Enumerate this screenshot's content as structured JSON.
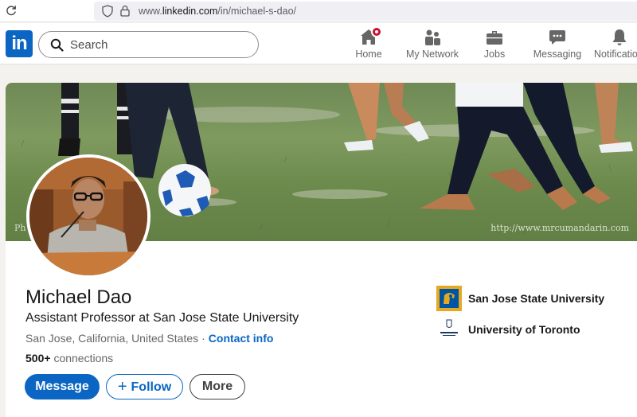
{
  "browser": {
    "url_prefix": "www.",
    "url_domain": "linkedin.com",
    "url_path": "/in/michael-s-dao/"
  },
  "nav": {
    "logo_text": "in",
    "search_placeholder": "Search",
    "items": [
      {
        "label": "Home",
        "icon": "home-icon",
        "badge": true
      },
      {
        "label": "My Network",
        "icon": "network-icon"
      },
      {
        "label": "Jobs",
        "icon": "briefcase-icon"
      },
      {
        "label": "Messaging",
        "icon": "messaging-icon"
      },
      {
        "label": "Notificatio",
        "icon": "bell-icon"
      }
    ]
  },
  "profile": {
    "banner_watermark": "http://www.mrcumandarin.com",
    "banner_corner_text": "Ph",
    "name": "Michael Dao",
    "headline": "Assistant Professor at San Jose State University",
    "location": "San Jose, California, United States",
    "separator": "·",
    "contact_label": "Contact info",
    "connections_count": "500+",
    "connections_label": "connections",
    "buttons": {
      "message": "Message",
      "follow": "Follow",
      "more": "More"
    },
    "education": [
      {
        "name": "San Jose State University",
        "icon": "sjsu-logo"
      },
      {
        "name": "University of Toronto",
        "icon": "uoft-logo"
      }
    ]
  },
  "colors": {
    "brand": "#0a66c2",
    "badge": "#cb112d"
  }
}
